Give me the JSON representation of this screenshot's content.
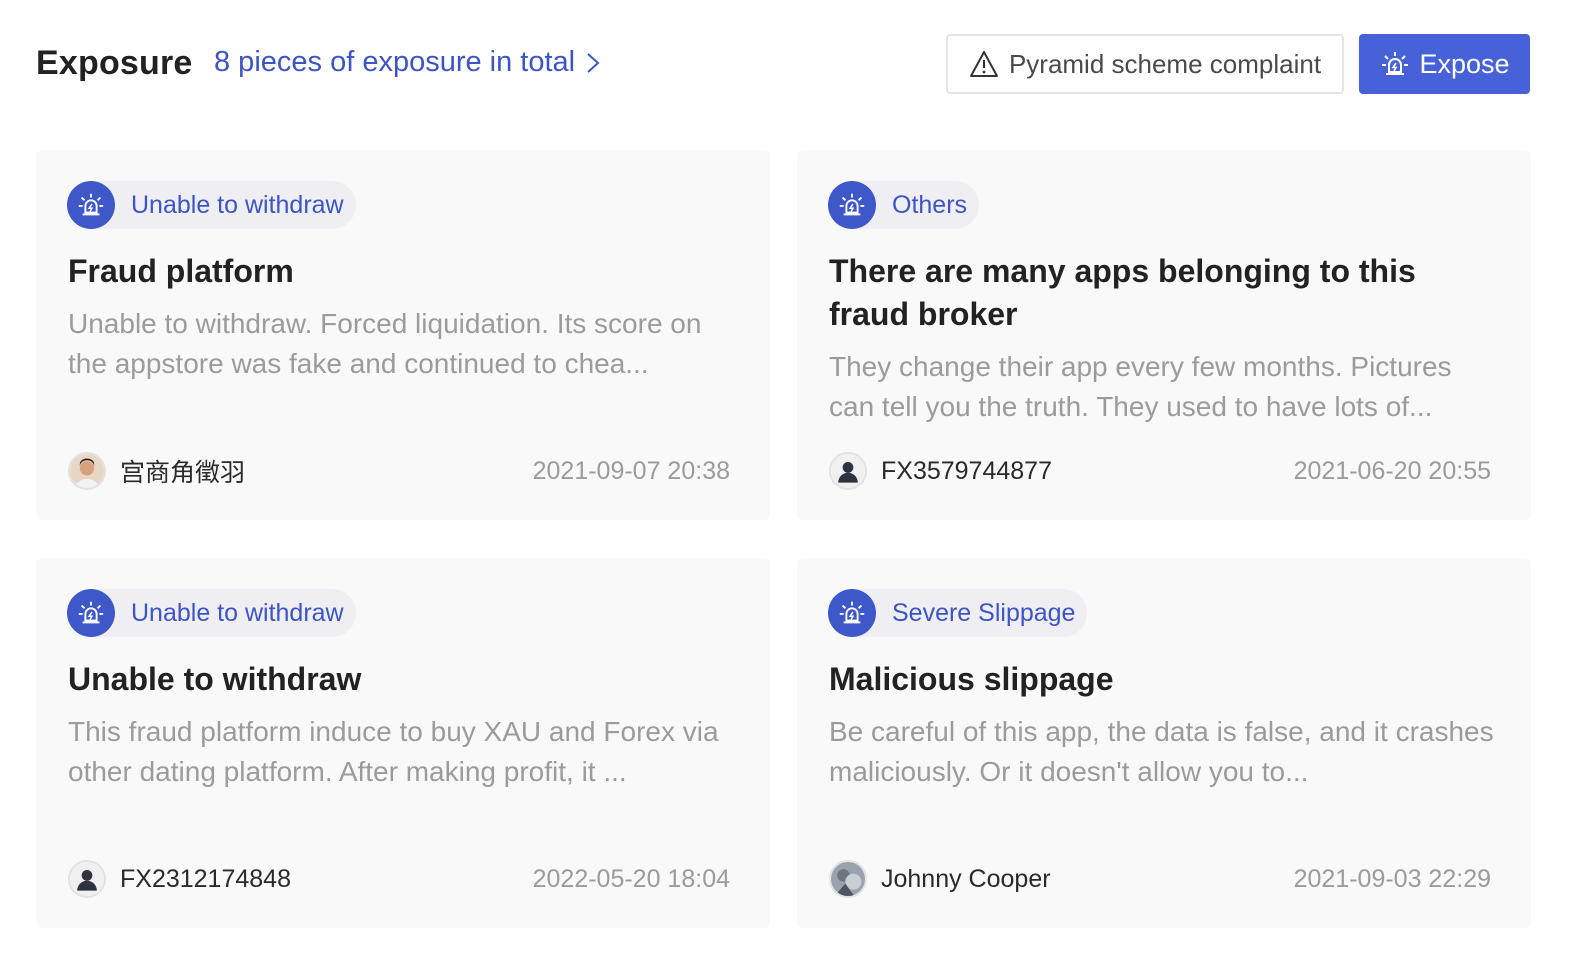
{
  "header": {
    "title": "Exposure",
    "total_link": "8 pieces of exposure in total",
    "complaint_button": "Pyramid scheme complaint",
    "expose_button": "Expose"
  },
  "colors": {
    "accent": "#4761d8",
    "link": "#3c54c6",
    "card_bg": "#f9f9fa",
    "muted_text": "#9b9b9b"
  },
  "cards": [
    {
      "tag": "Unable to withdraw",
      "title": "Fraud platform",
      "desc": "Unable to withdraw. Forced liquidation. Its score on the appstore was fake and continued to chea...",
      "author": "宫商角徵羽",
      "avatar": "photo-avatar",
      "date": "2021-09-07 20:38"
    },
    {
      "tag": "Others",
      "title": "There are many apps belonging to this fraud broker",
      "desc": "They change their app every few months. Pictures can tell you the truth. They used to have lots of...",
      "author": "FX3579744877",
      "avatar": "default-user-avatar",
      "date": "2021-06-20 20:55"
    },
    {
      "tag": "Unable to withdraw",
      "title": "Unable to withdraw",
      "desc": "This fraud platform induce to buy XAU and Forex via other dating platform. After making profit, it ...",
      "author": "FX2312174848",
      "avatar": "default-user-avatar",
      "date": "2022-05-20 18:04"
    },
    {
      "tag": "Severe Slippage",
      "title": "Malicious slippage",
      "desc": "Be careful of this app, the data is false, and it crashes maliciously. Or it doesn't allow you to...",
      "author": "Johnny Cooper",
      "avatar": "photo-avatar",
      "date": "2021-09-03 22:29"
    }
  ]
}
